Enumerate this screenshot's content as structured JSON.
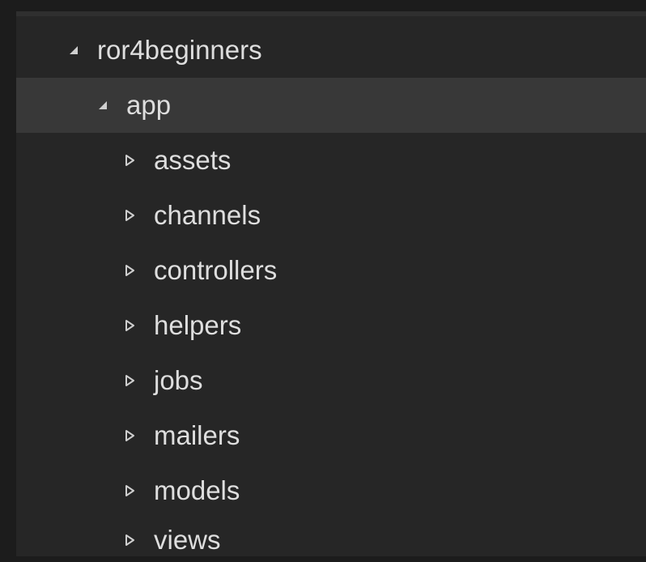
{
  "explorer": {
    "root": {
      "label": "ror4beginners",
      "expanded": true
    },
    "app": {
      "label": "app",
      "expanded": true,
      "selected": true
    },
    "children": [
      {
        "label": "assets",
        "expanded": false
      },
      {
        "label": "channels",
        "expanded": false
      },
      {
        "label": "controllers",
        "expanded": false
      },
      {
        "label": "helpers",
        "expanded": false
      },
      {
        "label": "jobs",
        "expanded": false
      },
      {
        "label": "mailers",
        "expanded": false
      },
      {
        "label": "models",
        "expanded": false
      },
      {
        "label": "views",
        "expanded": false
      }
    ]
  },
  "icons": {
    "expanded": "triangle-down-icon",
    "collapsed": "triangle-right-icon"
  },
  "colors": {
    "background": "#1c1c1c",
    "panel": "#262626",
    "selected_row": "#383838",
    "text": "#dedede",
    "twisty": "#cfcfcf"
  }
}
